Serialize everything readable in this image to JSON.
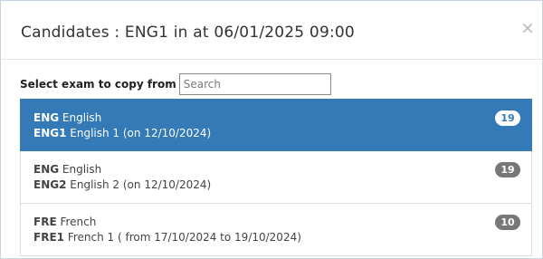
{
  "modal": {
    "title": "Candidates : ENG1 in at 06/01/2025 09:00",
    "close_symbol": "×"
  },
  "search": {
    "label": "Select exam to copy from",
    "placeholder": "Search",
    "value": ""
  },
  "exams": [
    {
      "subject_code": "ENG",
      "subject_name": "English",
      "exam_code": "ENG1",
      "exam_desc": "English 1 (on 12/10/2024)",
      "count": "19",
      "selected": true
    },
    {
      "subject_code": "ENG",
      "subject_name": "English",
      "exam_code": "ENG2",
      "exam_desc": "English 2 (on 12/10/2024)",
      "count": "19",
      "selected": false
    },
    {
      "subject_code": "FRE",
      "subject_name": "French",
      "exam_code": "FRE1",
      "exam_desc": "French 1 ( from 17/10/2024 to 19/10/2024)",
      "count": "10",
      "selected": false
    }
  ],
  "colors": {
    "active_bg": "#337ab7",
    "badge_bg": "#777777"
  }
}
